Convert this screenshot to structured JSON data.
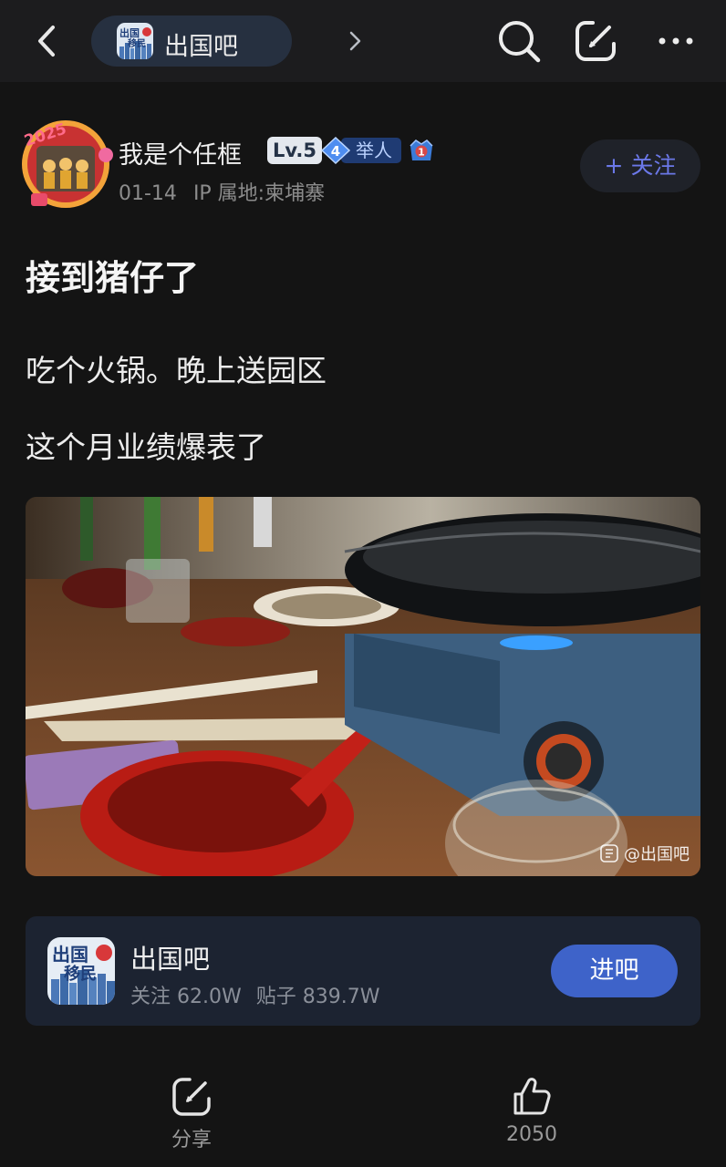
{
  "header": {
    "back_icon": "chevron-left-icon",
    "forum_name": "出国吧",
    "forum_chevron_icon": "chevron-right-icon",
    "search_icon": "search-icon",
    "edit_icon": "edit-icon",
    "more_icon": "more-icon",
    "logo_text_top": "出国",
    "logo_text_bottom": "移民"
  },
  "author": {
    "name": "我是个任框",
    "level": "Lv.5",
    "fan_level": "4",
    "fan_title": "举人",
    "rank": "1",
    "date": "01-14",
    "ip_location": "IP 属地:柬埔寨",
    "avatar_year": "2025"
  },
  "follow_button": "+ 关注",
  "post": {
    "title": "接到猪仔了",
    "lines": [
      "吃个火锅。晚上送园区",
      "这个月业绩爆表了"
    ],
    "image_watermark": "@出国吧"
  },
  "forum_card": {
    "name": "出国吧",
    "follows": "关注 62.0W",
    "posts": "贴子 839.7W",
    "enter_label": "进吧"
  },
  "actions": {
    "share_label": "分享",
    "like_count": "2050"
  },
  "colors": {
    "background": "#141414",
    "accent_follow": "#6b78e8",
    "enter_button": "#3e63c9",
    "card_bg": "#1c2331"
  }
}
